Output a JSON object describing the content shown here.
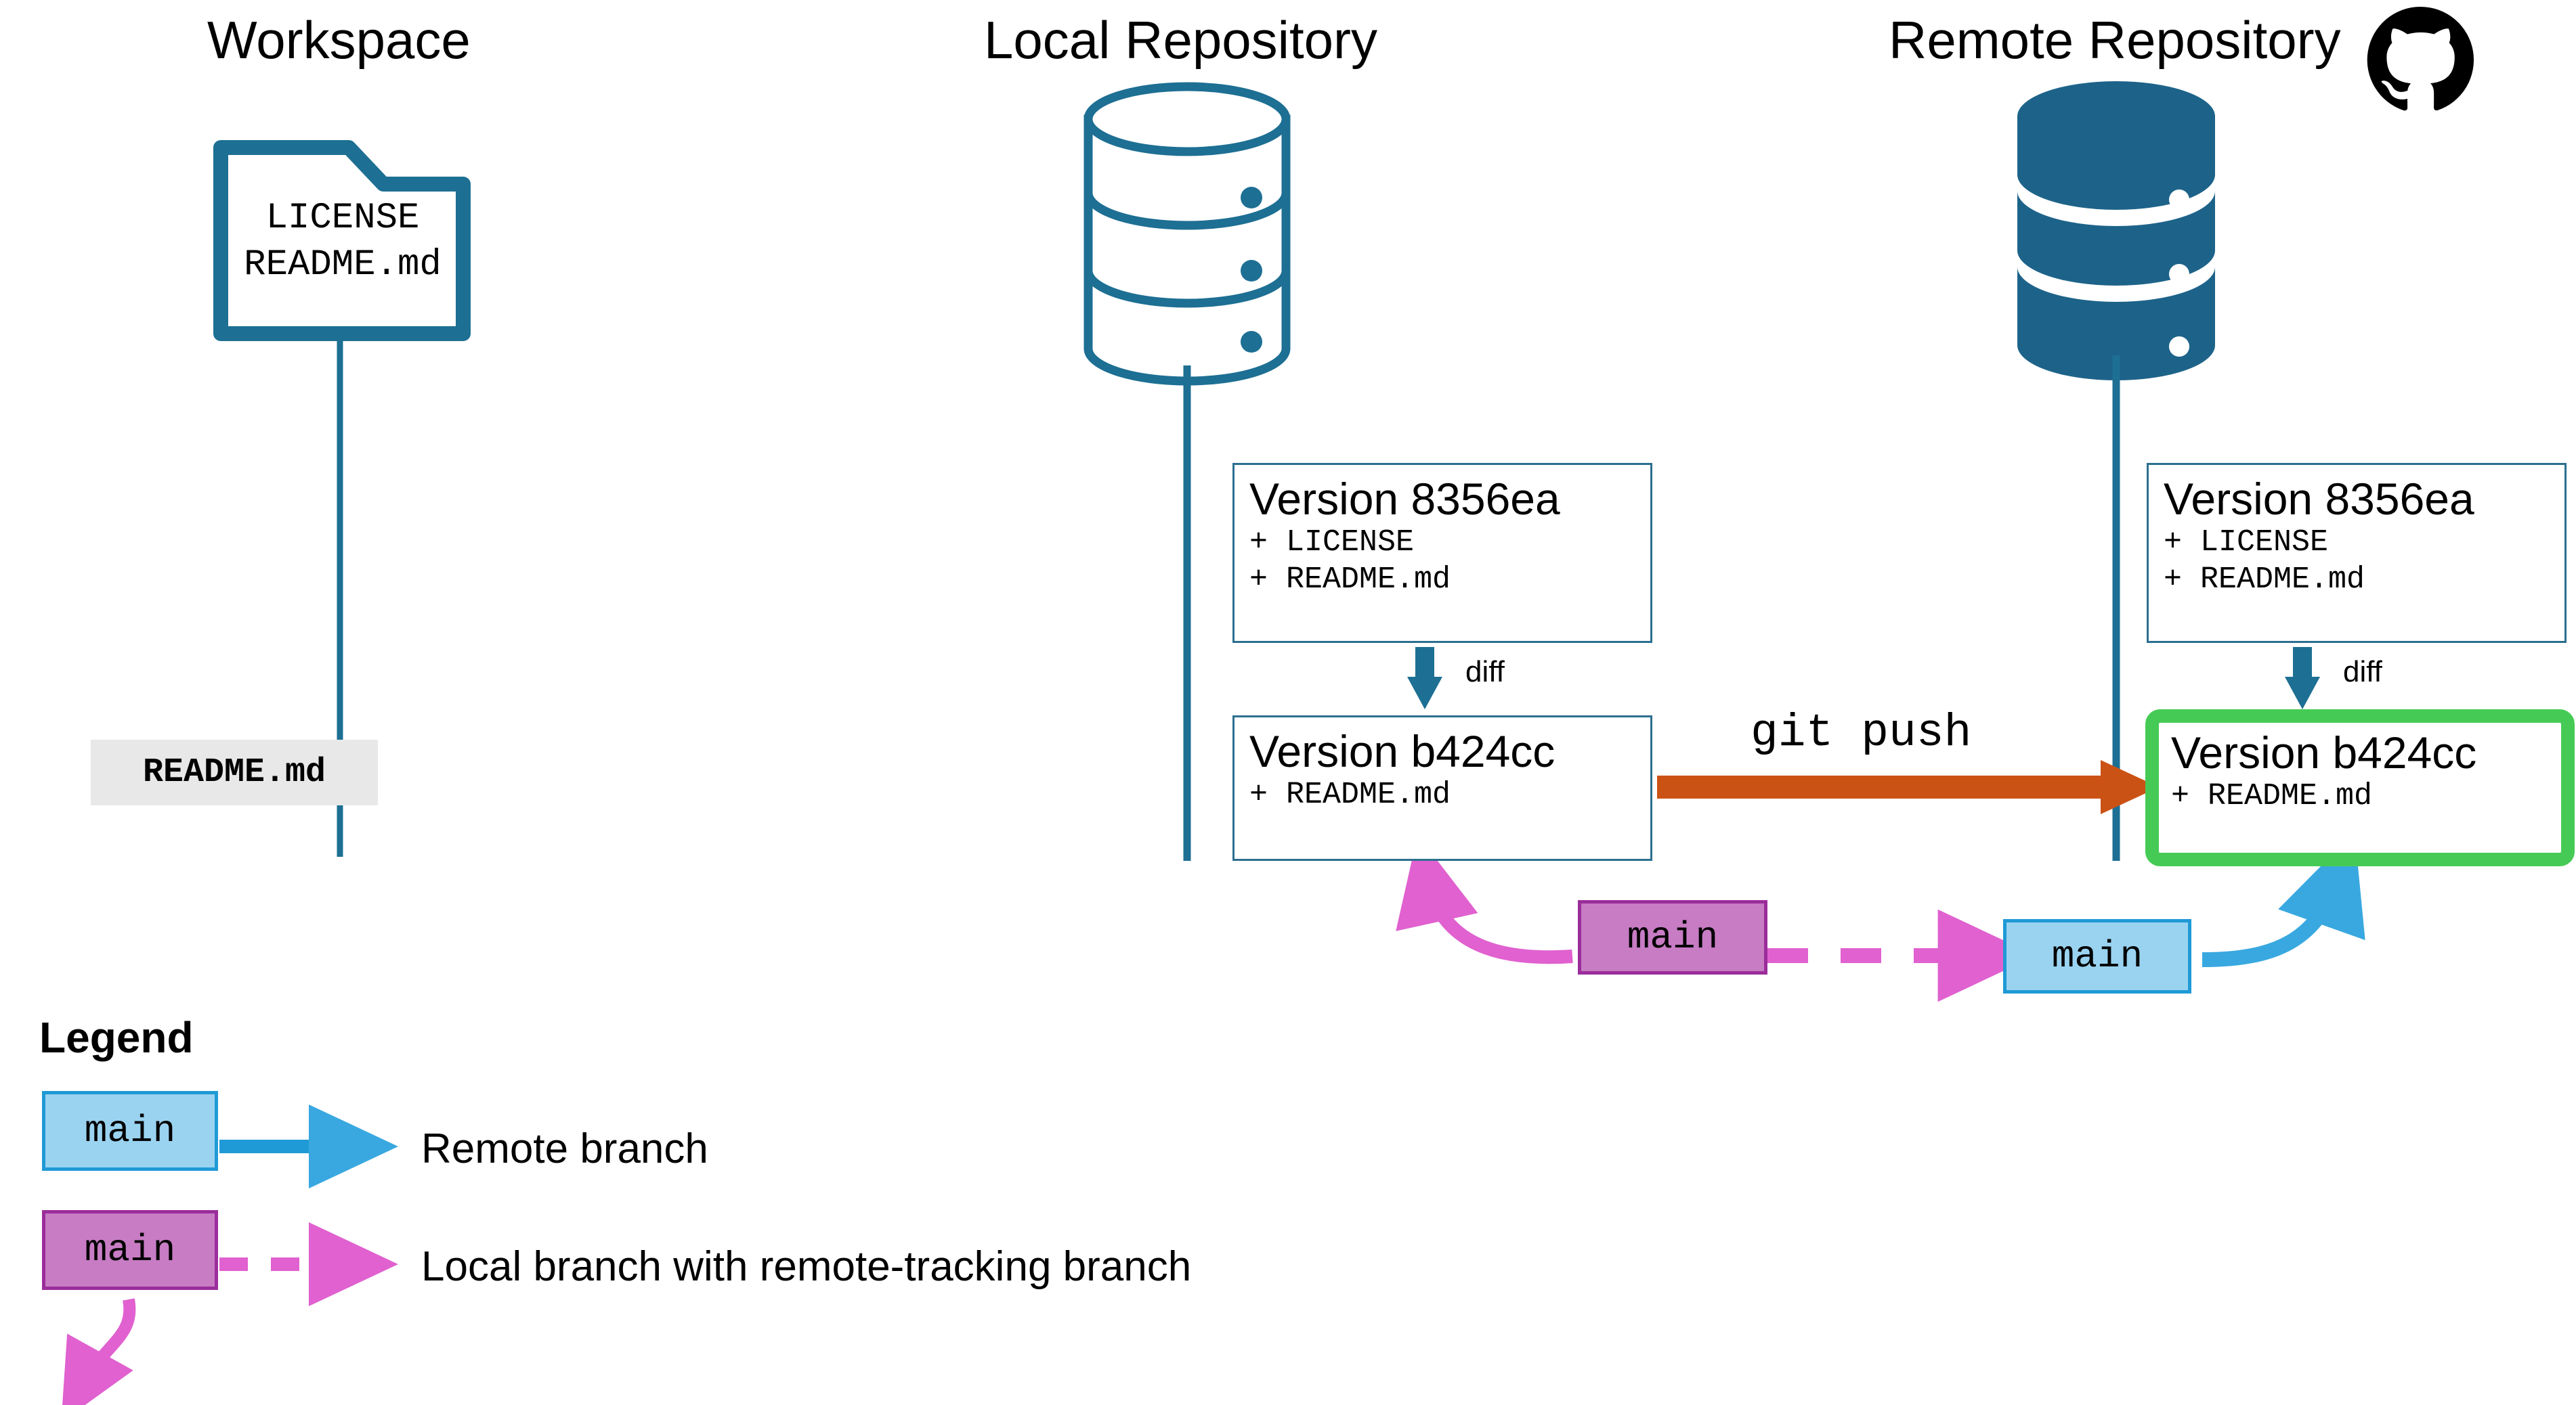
{
  "columns": {
    "workspace": {
      "title": "Workspace"
    },
    "local": {
      "title": "Local Repository"
    },
    "remote": {
      "title": "Remote Repository",
      "icon": "github-octocat-icon"
    }
  },
  "workspace": {
    "folder_icon": "folder-icon",
    "folder_files": "LICENSE\nREADME.md",
    "changed_file": "README.md"
  },
  "local_repo": {
    "db_icon": "database-stack-icon",
    "versions": [
      {
        "title": "Version 8356ea",
        "lines": [
          "+ LICENSE",
          "+ README.md"
        ]
      },
      {
        "title": "Version b424cc",
        "lines": [
          "+ README.md"
        ]
      }
    ],
    "diff_label": "diff",
    "branch_chip": "main"
  },
  "remote_repo": {
    "db_icon": "database-stack-filled-icon",
    "versions": [
      {
        "title": "Version 8356ea",
        "lines": [
          "+ LICENSE",
          "+ README.md"
        ]
      },
      {
        "title": "Version b424cc",
        "lines": [
          "+ README.md"
        ]
      }
    ],
    "diff_label": "diff",
    "branch_chip": "main"
  },
  "transfer": {
    "command_label": "git push"
  },
  "legend": {
    "title": "Legend",
    "items": [
      {
        "chip": "main",
        "type": "remote",
        "text": "Remote branch"
      },
      {
        "chip": "main",
        "type": "local",
        "text": "Local branch with remote-tracking branch"
      }
    ]
  },
  "colors": {
    "teal": "#1d6f93",
    "teal_dark": "#15536e",
    "box_border": "#2c6f8f",
    "highlight_green": "#45cb55",
    "push_orange": "#cb5215",
    "branch_local_fill": "#c77cc4",
    "branch_local_border": "#9b2d9b",
    "branch_remote_fill": "#9ad3f0",
    "branch_remote_border": "#1f9ad6",
    "pink_arrow": "#e061cf",
    "blue_arrow": "#39a8e0",
    "chip_gray": "#e8e8e8"
  }
}
